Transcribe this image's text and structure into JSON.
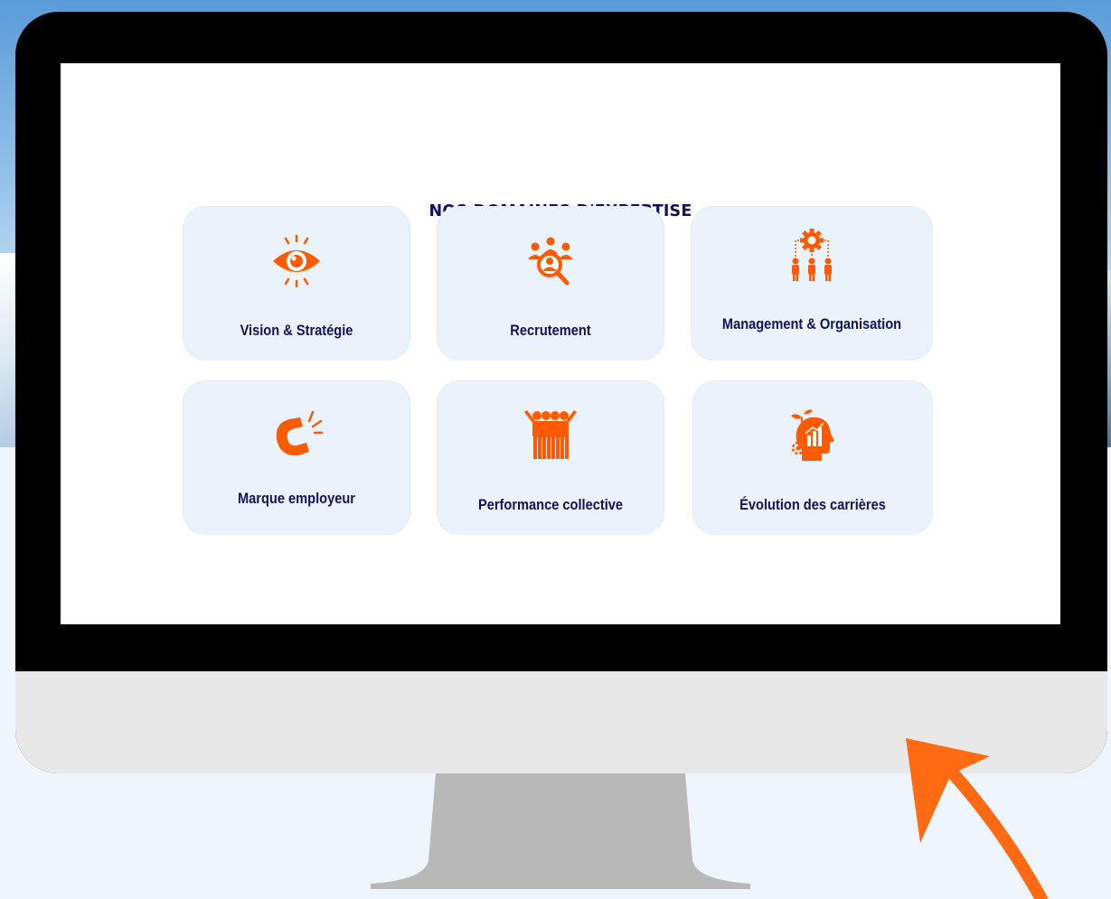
{
  "page": {
    "title": "NOS DOMAINES D'EXPERTISE"
  },
  "cards": [
    {
      "label": "Vision & Stratégie",
      "icon": "eye-icon"
    },
    {
      "label": "Recrutement",
      "icon": "recruitment-search-icon"
    },
    {
      "label": "Management & Organisation",
      "icon": "organization-chart-icon"
    },
    {
      "label": "Marque employeur",
      "icon": "magnet-icon"
    },
    {
      "label": "Performance collective",
      "icon": "team-cheering-icon"
    },
    {
      "label": "Évolution des carrières",
      "icon": "head-growth-icon"
    }
  ],
  "colors": {
    "accent": "#ff5a00",
    "heading": "#12135a",
    "card_bg": "#eaf3fb",
    "arrow": "#ff6a13"
  }
}
